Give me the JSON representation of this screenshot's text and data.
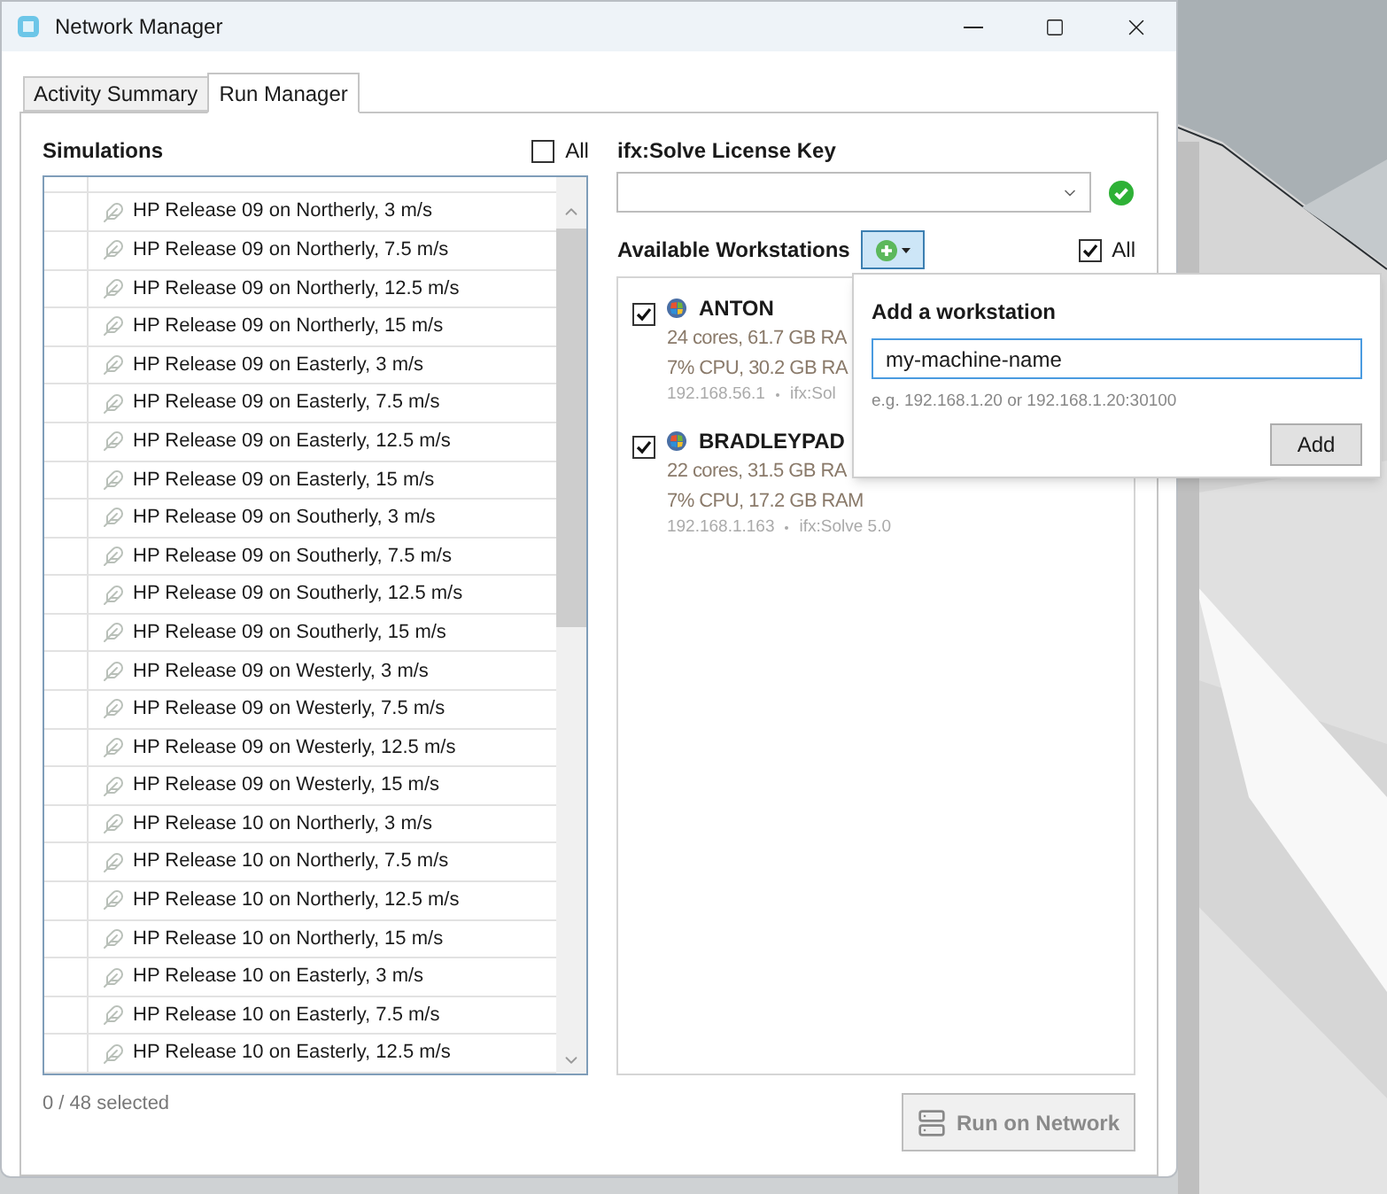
{
  "window": {
    "title": "Network Manager"
  },
  "tabs": [
    {
      "label": "Activity Summary",
      "selected": false
    },
    {
      "label": "Run Manager",
      "selected": true
    }
  ],
  "simulations": {
    "title": "Simulations",
    "all_label": "All",
    "all_checked": false,
    "rows": [
      "HP Release 09 on Northerly, 3 m/s",
      "HP Release 09 on Northerly, 7.5 m/s",
      "HP Release 09 on Northerly, 12.5 m/s",
      "HP Release 09 on Northerly, 15 m/s",
      "HP Release 09 on Easterly, 3 m/s",
      "HP Release 09 on Easterly, 7.5 m/s",
      "HP Release 09 on Easterly, 12.5 m/s",
      "HP Release 09 on Easterly, 15 m/s",
      "HP Release 09 on Southerly, 3 m/s",
      "HP Release 09 on Southerly, 7.5 m/s",
      "HP Release 09 on Southerly, 12.5 m/s",
      "HP Release 09 on Southerly, 15 m/s",
      "HP Release 09 on Westerly, 3 m/s",
      "HP Release 09 on Westerly, 7.5 m/s",
      "HP Release 09 on Westerly, 12.5 m/s",
      "HP Release 09 on Westerly, 15 m/s",
      "HP Release 10 on Northerly, 3 m/s",
      "HP Release 10 on Northerly, 7.5 m/s",
      "HP Release 10 on Northerly, 12.5 m/s",
      "HP Release 10 on Northerly, 15 m/s",
      "HP Release 10 on Easterly, 3 m/s",
      "HP Release 10 on Easterly, 7.5 m/s",
      "HP Release 10 on Easterly, 12.5 m/s"
    ],
    "count": "0 / 48 selected"
  },
  "license": {
    "label": "ifx:Solve License Key",
    "valid": true
  },
  "workstations": {
    "label": "Available Workstations",
    "all_label": "All",
    "all_checked": true,
    "items": [
      {
        "name": "ANTON",
        "checked": true,
        "specs": "24 cores, 61.7 GB RA",
        "usage": "7% CPU, 30.2 GB RA",
        "address": "192.168.56.1",
        "version": "ifx:Sol"
      },
      {
        "name": "BRADLEYPAD",
        "checked": true,
        "specs": "22 cores, 31.5 GB RA",
        "usage": "7% CPU, 17.2 GB RAM",
        "address": "192.168.1.163",
        "version": "ifx:Solve 5.0"
      }
    ]
  },
  "popup": {
    "title": "Add a workstation",
    "value": "my-machine-name",
    "hint": "e.g. 192.168.1.20 or 192.168.1.20:30100",
    "button": "Add"
  },
  "run_button": {
    "label": "Run on Network",
    "disabled": true
  }
}
